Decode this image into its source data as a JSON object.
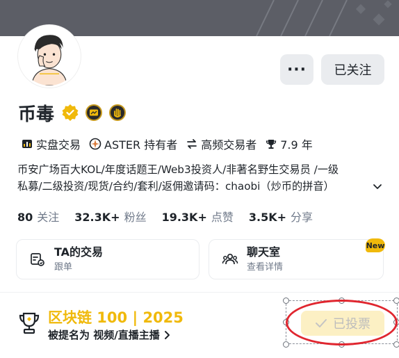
{
  "header": {
    "more_label": "···",
    "follow_label": "已关注"
  },
  "profile": {
    "name": "币毒",
    "tags": [
      {
        "icon": "grid-trade-icon",
        "label": "实盘交易"
      },
      {
        "icon": "aster-icon",
        "label": "ASTER 持有者"
      },
      {
        "icon": "swap-icon",
        "label": "高频交易者"
      },
      {
        "icon": "trophy-small-icon",
        "label": "7.9 年"
      }
    ],
    "bio_line1": "币安广场百大KOL/年度话题王/Web3投资人/非著名野生交易员 /一级",
    "bio_line2": "私募/二级投资/现货/合约/套利/返佣邀请码：chaobi（炒币的拼音）"
  },
  "stats": [
    {
      "num": "80",
      "label": "关注"
    },
    {
      "num": "32.3K+",
      "label": "粉丝"
    },
    {
      "num": "19.3K+",
      "label": "点赞"
    },
    {
      "num": "3.5K+",
      "label": "分享"
    }
  ],
  "cards": {
    "trades": {
      "title": "TA的交易",
      "sub": "跟单"
    },
    "chat": {
      "title": "聊天室",
      "sub": "查看详情",
      "badge": "New"
    }
  },
  "award": {
    "title": "区块链 100 | 2025",
    "sub": "被提名为 视频/直播主播",
    "vote_label": "已投票"
  },
  "colors": {
    "accent": "#f0b90b",
    "text": "#1e2329",
    "muted": "#707a8a",
    "annotation": "#e0262f"
  }
}
